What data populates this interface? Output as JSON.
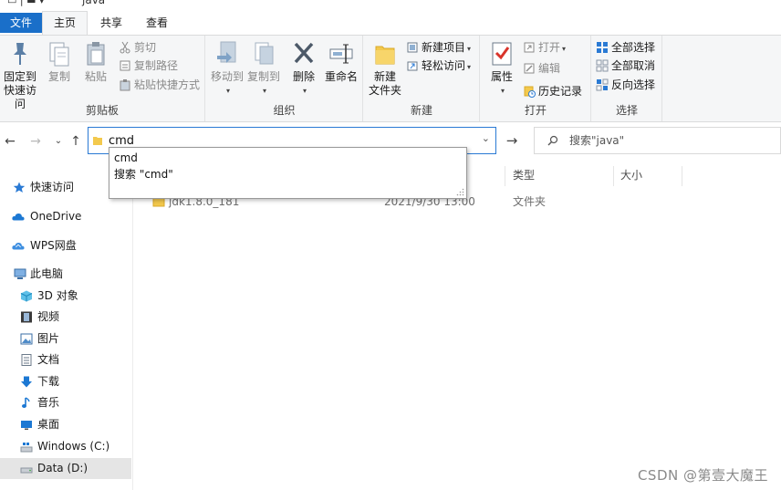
{
  "window": {
    "title": "java"
  },
  "ribbon_tabs": {
    "file": "文件",
    "home": "主页",
    "share": "共享",
    "view": "查看"
  },
  "clipboard": {
    "label": "剪贴板",
    "pin_line1": "固定到",
    "pin_line2": "快速访问",
    "copy": "复制",
    "paste": "粘贴",
    "cut": "剪切",
    "copy_path": "复制路径",
    "paste_shortcut": "粘贴快捷方式"
  },
  "organize": {
    "label": "组织",
    "move_to": "移动到",
    "copy_to": "复制到",
    "delete": "删除",
    "rename": "重命名"
  },
  "new_group": {
    "label": "新建",
    "new_item": "新建项目",
    "easy_access": "轻松访问",
    "new_folder_line1": "新建",
    "new_folder_line2": "文件夹"
  },
  "open_group": {
    "label": "打开",
    "properties": "属性",
    "open": "打开",
    "edit": "编辑",
    "history": "历史记录"
  },
  "select_group": {
    "label": "选择",
    "select_all": "全部选择",
    "select_none": "全部取消",
    "invert": "反向选择"
  },
  "address": {
    "value": "cmd"
  },
  "search": {
    "placeholder": "搜索\"java\""
  },
  "autocomplete": {
    "items": [
      "cmd",
      "搜索 \"cmd\""
    ]
  },
  "nav_pane": {
    "quick_access": "快速访问",
    "onedrive": "OneDrive",
    "wps": "WPS网盘",
    "this_pc": "此电脑",
    "objects3d": "3D 对象",
    "videos": "视频",
    "pictures": "图片",
    "documents": "文档",
    "downloads": "下载",
    "music": "音乐",
    "desktop": "桌面",
    "drive_c": "Windows (C:)",
    "drive_d": "Data (D:)"
  },
  "columns": {
    "type": "类型",
    "size": "大小"
  },
  "files": [
    {
      "name": "jdk1.8.0_181",
      "modified": "2021/9/30 13:00",
      "type": "文件夹"
    }
  ],
  "watermark": "CSDN @第壹大魔王",
  "colors": {
    "accent": "#1a6fc9",
    "folder": "#f3c94d",
    "selected_bg": "#e5e5e5"
  }
}
